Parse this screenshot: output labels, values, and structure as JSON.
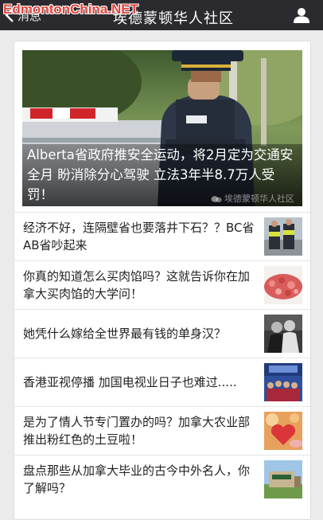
{
  "header": {
    "back_label": "消息",
    "title": "埃德蒙顿华人社区",
    "watermark": "EdmontonChina.NET"
  },
  "featured": {
    "title": "Alberta省政府推安全运动，将2月定为交通安全月 盼消除分心驾驶 立法3年半8.7万人受罚！",
    "watermark": "埃德蒙顿华人社区"
  },
  "articles": [
    {
      "title": "经济不好，连隔壁省也要落井下石？？BC省 AB省吵起来",
      "thumb_icon": "police-photo-thumbnail"
    },
    {
      "title": "你真的知道怎么买肉馅吗？这就告诉你在加拿大买肉馅的大学问！",
      "thumb_icon": "ground-meat-thumbnail"
    },
    {
      "title": "她凭什么嫁给全世界最有钱的单身汉？",
      "thumb_icon": "couple-photo-thumbnail"
    },
    {
      "title": "香港亚视停播 加国电视业日子也难过.....",
      "thumb_icon": "tv-studio-thumbnail"
    },
    {
      "title": "是为了情人节专门置办的吗？加拿大农业部推出粉红色的土豆啦！",
      "thumb_icon": "heart-potato-thumbnail"
    },
    {
      "title": "盘点那些从加拿大毕业的古今中外名人，你了解吗？",
      "thumb_icon": "alberta-campus-thumbnail"
    }
  ]
}
